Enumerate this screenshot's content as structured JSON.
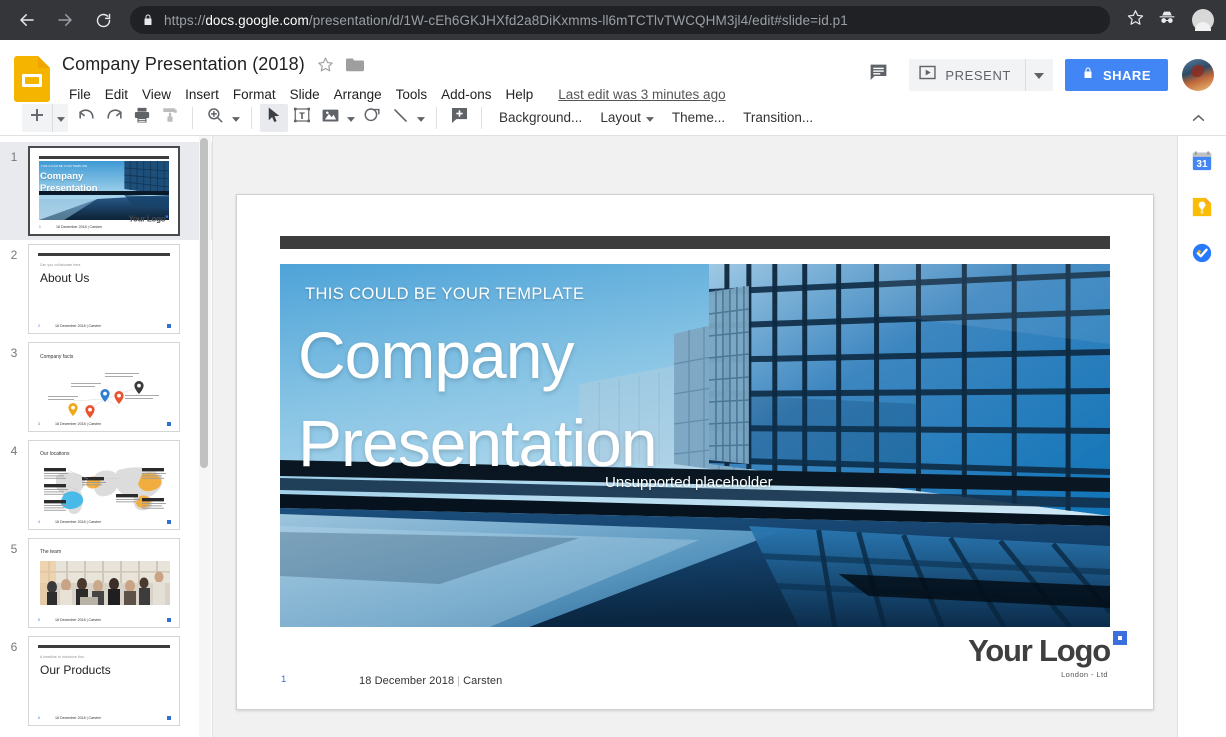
{
  "browser": {
    "url_prefix": "https://",
    "url_host": "docs.google.com",
    "url_path": "/presentation/d/1W-cEh6GKJHXfd2a8DiKxmms-ll6mTCTlvTWCQHM3jl4/edit#slide=id.p1",
    "back_icon": "back-arrow-icon",
    "forward_icon": "forward-arrow-icon",
    "reload_icon": "reload-icon",
    "lock_icon": "lock-icon",
    "star_icon": "bookmark-star-icon",
    "incognito_icon": "incognito-icon"
  },
  "header": {
    "doc_title": "Company Presentation (2018)",
    "star_icon": "star-icon",
    "folder_icon": "folder-icon",
    "menus": [
      "File",
      "Edit",
      "View",
      "Insert",
      "Format",
      "Slide",
      "Arrange",
      "Tools",
      "Add-ons",
      "Help"
    ],
    "last_edit": "Last edit was 3 minutes ago",
    "comment_icon": "comment-icon",
    "present_label": "PRESENT",
    "present_caret_icon": "chevron-down-icon",
    "share_label": "SHARE",
    "share_lock_icon": "lock-icon",
    "avatar": "user-avatar",
    "share_color": "#4285f4"
  },
  "toolbar": {
    "new_slide_icon": "add-slide-icon",
    "new_slide_caret_icon": "chevron-down-icon",
    "undo_icon": "undo-icon",
    "redo_icon": "redo-icon",
    "print_icon": "print-icon",
    "paint_format_icon": "paint-format-icon",
    "zoom_icon": "zoom-icon",
    "zoom_caret_icon": "chevron-down-icon",
    "select_icon": "cursor-select-icon",
    "textbox_icon": "text-box-icon",
    "image_icon": "image-icon",
    "image_caret_icon": "chevron-down-icon",
    "shape_icon": "shape-icon",
    "line_icon": "line-icon",
    "line_caret_icon": "chevron-down-icon",
    "comment_icon": "add-comment-icon",
    "background_label": "Background...",
    "layout_label": "Layout",
    "layout_caret_icon": "chevron-down-icon",
    "theme_label": "Theme...",
    "transition_label": "Transition...",
    "collapse_icon": "chevron-up-icon"
  },
  "filmstrip": {
    "slides": [
      {
        "num": "1",
        "type": "hero",
        "eyebrow": "THIS COULD BE YOUR TEMPLATE",
        "title": "Company Presentation",
        "selected": true,
        "footer_num": "1",
        "footer_text": "18 December 2018 | Carsten",
        "logo": "Your Logo"
      },
      {
        "num": "2",
        "type": "title",
        "eyebrow": "Can you collaborate here.",
        "title": "About Us",
        "selected": false,
        "footer_num": "2",
        "footer_text": "18 December 2018 | Carsten"
      },
      {
        "num": "3",
        "type": "facts",
        "title": "Company facts",
        "selected": false,
        "footer_num": "3",
        "footer_text": "18 December 2018 | Carsten"
      },
      {
        "num": "4",
        "type": "map",
        "title": "Our locations",
        "selected": false,
        "footer_num": "4",
        "footer_text": "18 December 2018 | Carsten"
      },
      {
        "num": "5",
        "type": "photo",
        "title": "The team",
        "selected": false,
        "footer_num": "5",
        "footer_text": "18 December 2018 | Carsten"
      },
      {
        "num": "6",
        "type": "title",
        "eyebrow": "A headline to introduce this.",
        "title": "Our Products",
        "selected": false,
        "footer_num": "6",
        "footer_text": "18 December 2018 | Carsten"
      }
    ]
  },
  "slide": {
    "eyebrow": "THIS COULD BE YOUR TEMPLATE",
    "title": "Company Presentation",
    "placeholder": "Unsupported placeholder",
    "footer_num": "1",
    "footer_date": "18 December 2018",
    "footer_sep": "|",
    "footer_author": "Carsten",
    "logo_text": "Your Logo",
    "logo_sub": "London - Ltd",
    "accent_color": "#3b6fe0"
  },
  "right_rail": {
    "items": [
      {
        "icon": "google-calendar-icon",
        "label": "31"
      },
      {
        "icon": "google-keep-icon",
        "label": ""
      },
      {
        "icon": "google-tasks-icon",
        "label": ""
      }
    ]
  }
}
